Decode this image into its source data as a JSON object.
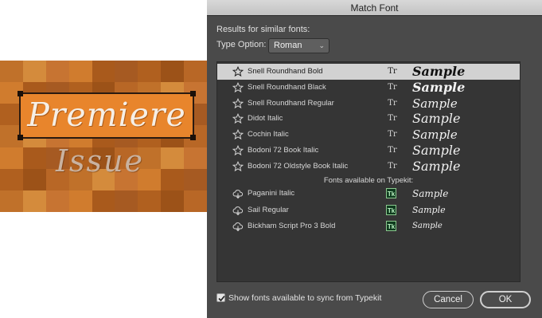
{
  "canvas": {
    "headline": "Premiere",
    "subhead": "Issue"
  },
  "dialog": {
    "title": "Match Font",
    "results_heading": "Results for similar fonts:",
    "type_option_label": "Type Option:",
    "type_option_value": "Roman",
    "typekit_heading": "Fonts available on Typekit:",
    "sync_label": "Show fonts available to sync from Typekit",
    "sync_checked": true,
    "cancel_label": "Cancel",
    "ok_label": "OK",
    "type_icon_glyph": "Tr",
    "typekit_badge": "Tk"
  },
  "fonts": [
    {
      "name": "Snell Roundhand Bold",
      "sample": "Sample",
      "source": "local",
      "icon": "star-icon",
      "selected": true
    },
    {
      "name": "Snell Roundhand Black",
      "sample": "Sample",
      "source": "local",
      "icon": "star-icon",
      "selected": false
    },
    {
      "name": "Snell Roundhand Regular",
      "sample": "Sample",
      "source": "local",
      "icon": "star-icon",
      "selected": false
    },
    {
      "name": "Didot Italic",
      "sample": "Sample",
      "source": "local",
      "icon": "star-icon",
      "selected": false
    },
    {
      "name": "Cochin Italic",
      "sample": "Sample",
      "source": "local",
      "icon": "star-icon",
      "selected": false
    },
    {
      "name": "Bodoni 72 Book Italic",
      "sample": "Sample",
      "source": "local",
      "icon": "star-icon",
      "selected": false
    },
    {
      "name": "Bodoni 72 Oldstyle Book Italic",
      "sample": "Sample",
      "source": "local",
      "icon": "star-icon",
      "selected": false
    }
  ],
  "typekit_fonts": [
    {
      "name": "Paganini Italic",
      "sample": "Sample",
      "source": "typekit",
      "icon": "cloud-download-icon"
    },
    {
      "name": "Sail Regular",
      "sample": "Sample",
      "source": "typekit",
      "icon": "cloud-download-icon"
    },
    {
      "name": "Bickham Script Pro 3 Bold",
      "sample": "Sample",
      "source": "typekit",
      "icon": "cloud-download-icon"
    }
  ],
  "colors": {
    "dialog_bg": "#4a4a4a",
    "list_bg": "#353535",
    "selected_row": "#d2d2d2",
    "canvas_orange": "#e8852c"
  }
}
